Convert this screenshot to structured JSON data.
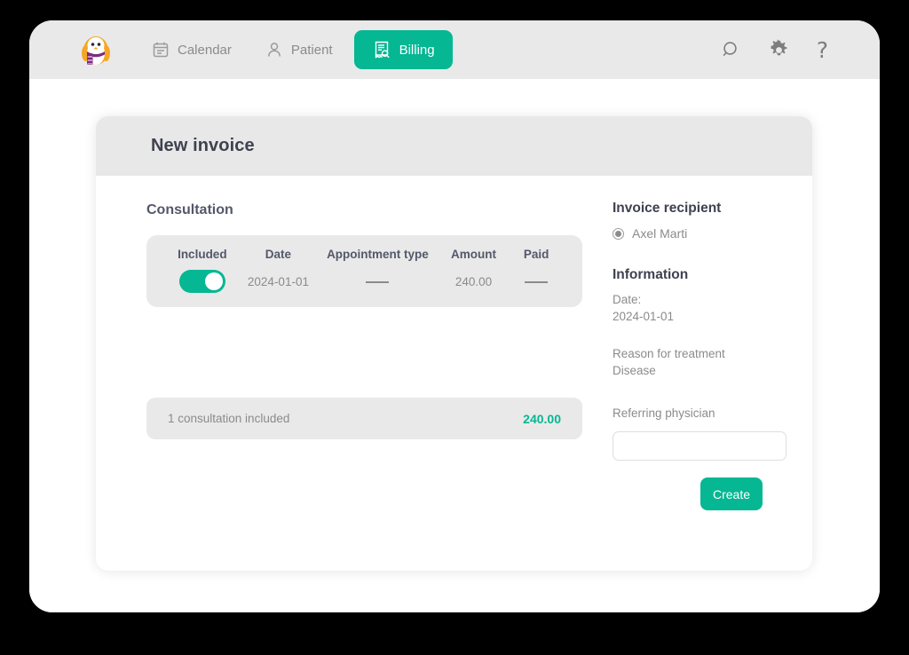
{
  "topbar": {
    "logo_icon": "penguin-mascot-logo",
    "nav": [
      {
        "label": "Calendar",
        "icon": "calendar-icon",
        "active": false
      },
      {
        "label": "Patient",
        "icon": "person-icon",
        "active": false
      },
      {
        "label": "Billing",
        "icon": "invoice-search-icon",
        "active": true
      }
    ],
    "actions": [
      {
        "icon": "search-icon",
        "label": ""
      },
      {
        "icon": "gear-icon",
        "label": ""
      },
      {
        "icon": "help-icon",
        "label": "?"
      }
    ]
  },
  "card": {
    "title": "New invoice",
    "section_title": "Consultation",
    "table": {
      "headers": [
        "Included",
        "Date",
        "Appointment type",
        "Amount",
        "Paid"
      ],
      "rows": [
        {
          "included": true,
          "date": "2024-01-01",
          "appointment_type": "—",
          "amount": "240.00",
          "paid": "—"
        }
      ]
    },
    "summary": {
      "label": "1 consultation included",
      "total": "240.00"
    },
    "recipient": {
      "heading": "Invoice recipient",
      "options": [
        {
          "label": "Axel Marti",
          "selected": true
        }
      ]
    },
    "information": {
      "heading": "Information",
      "date_label": "Date:",
      "date_value": "2024-01-01",
      "reason_label": "Reason for treatment",
      "reason_value": "Disease",
      "physician_label": "Referring physician",
      "physician_value": "",
      "physician_placeholder": ""
    },
    "create_label": "Create"
  },
  "colors": {
    "accent": "#05b793",
    "topbar_bg": "#e9e9e9",
    "card_header_bg": "#e8e8e8",
    "panel_bg": "#e9e9e9",
    "text_dark": "#3e4250",
    "text_muted": "#8b8b8b",
    "window_bg": "#ffffff",
    "page_bg": "#000000"
  }
}
